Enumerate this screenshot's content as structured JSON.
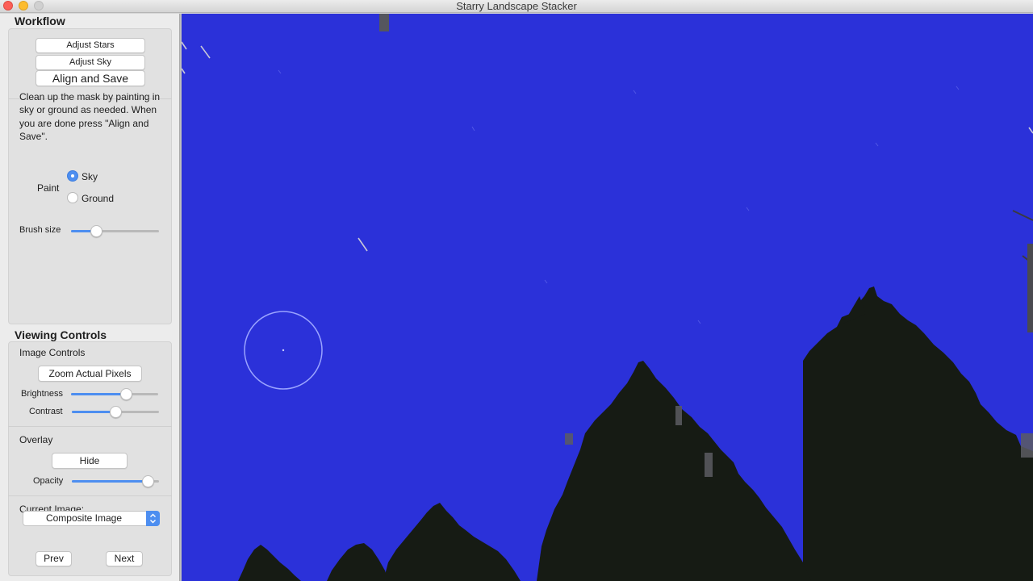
{
  "window": {
    "title": "Starry Landscape Stacker"
  },
  "workflow": {
    "heading": "Workflow",
    "buttons": {
      "adjust_stars": "Adjust Stars",
      "adjust_sky": "Adjust Sky",
      "align_and_save": "Align and Save"
    },
    "instructions": "Clean up the mask by painting in sky or ground as needed. When you are done press \"Align and Save\".",
    "paint": {
      "label": "Paint",
      "options": [
        {
          "label": "Sky",
          "selected": true
        },
        {
          "label": "Ground",
          "selected": false
        }
      ]
    },
    "brush_size": {
      "label": "Brush size",
      "value": 0.28
    }
  },
  "viewing_controls": {
    "heading": "Viewing Controls",
    "image_controls": {
      "label": "Image Controls",
      "zoom_button": "Zoom Actual Pixels",
      "brightness": {
        "label": "Brightness",
        "value": 0.63
      },
      "contrast": {
        "label": "Contrast",
        "value": 0.5
      }
    },
    "overlay": {
      "label": "Overlay",
      "hide_button": "Hide",
      "opacity": {
        "label": "Opacity",
        "value": 0.87
      }
    },
    "current_image": {
      "label": "Current Image:",
      "selected": "Composite Image",
      "prev_button": "Prev",
      "next_button": "Next"
    }
  },
  "colors": {
    "sky_mask": "#2b31d9",
    "accent": "#4d8ef0",
    "sidebar_bg": "#ececec"
  }
}
